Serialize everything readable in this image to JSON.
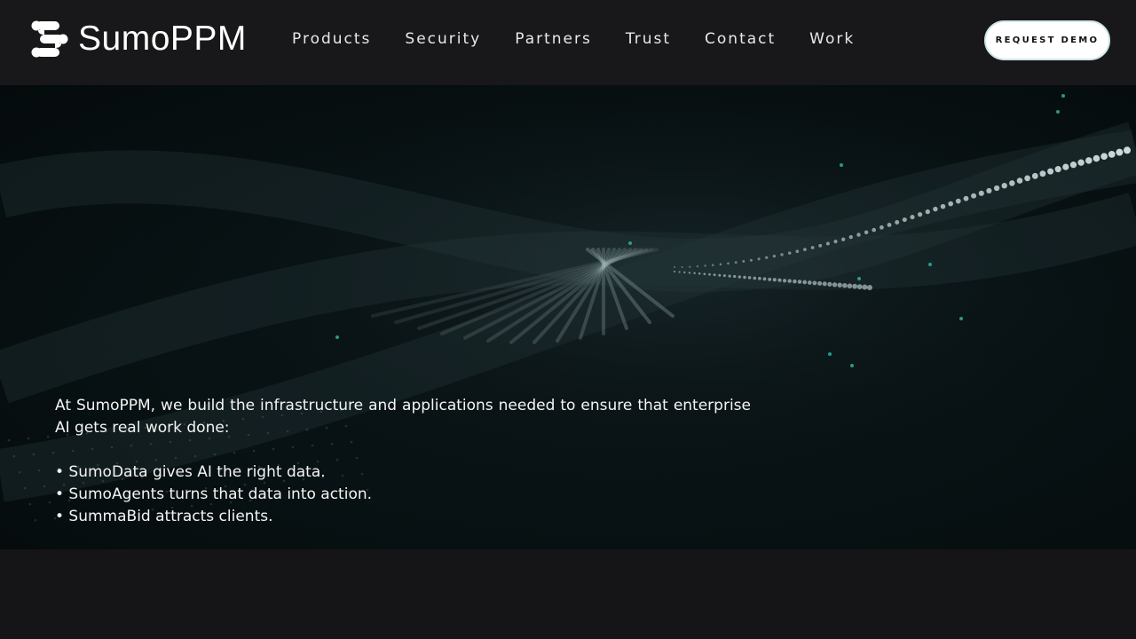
{
  "brand": {
    "name": "SumoPPM",
    "logo_icon": "sumo-mark-icon"
  },
  "nav": {
    "items": [
      {
        "label": "Products"
      },
      {
        "label": "Security"
      },
      {
        "label": "Partners"
      },
      {
        "label": "Trust"
      },
      {
        "label": "Contact"
      },
      {
        "label": "Work"
      }
    ],
    "cta_label": "REQUEST DEMO"
  },
  "hero": {
    "intro": "At SumoPPM, we build the infrastructure and applications needed to ensure that enterprise AI gets real work done:",
    "bullets": [
      "• SumoData gives AI the right data.",
      "• SumoAgents turns that data into action.",
      "• SummaBid attracts clients."
    ]
  },
  "colors": {
    "header_bg": "#181719",
    "hero_bg": "#081214",
    "accent_teal": "#2fb9a8",
    "cta_bg": "#ffffff",
    "cta_text": "#111111"
  }
}
